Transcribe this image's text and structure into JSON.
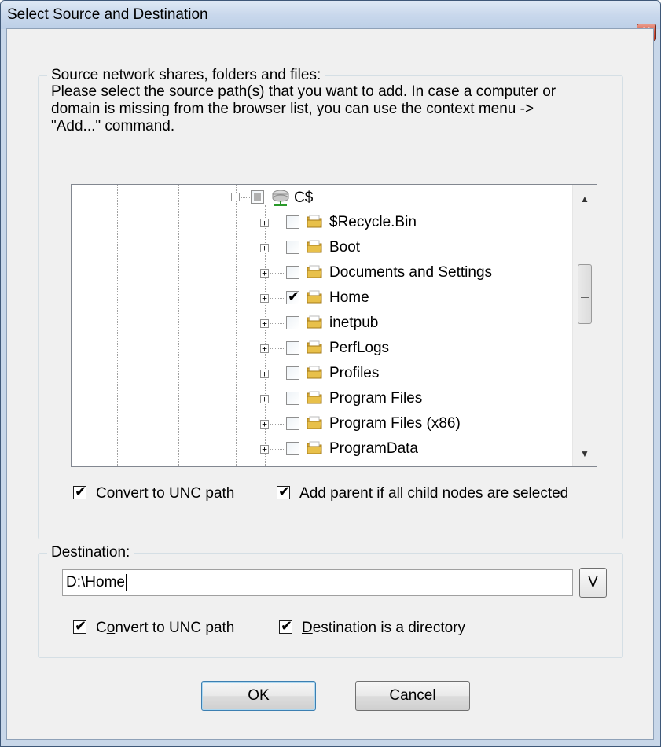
{
  "dialog": {
    "title": "Select Source and Destination",
    "close_label": "x"
  },
  "source_group": {
    "legend": "Source network shares, folders and files:",
    "description": "Please select the source path(s) that you want to add. In case a computer or domain is missing from the browser list, you can use the context menu -> \"Add...\" command."
  },
  "tree": {
    "root": {
      "label": "C$",
      "state": "partial",
      "expander": "−"
    },
    "items": [
      {
        "label": "$Recycle.Bin",
        "checked": false,
        "expander": "+"
      },
      {
        "label": "Boot",
        "checked": false,
        "expander": "+"
      },
      {
        "label": "Documents and Settings",
        "checked": false,
        "expander": "+"
      },
      {
        "label": "Home",
        "checked": true,
        "expander": "+"
      },
      {
        "label": "inetpub",
        "checked": false,
        "expander": "+"
      },
      {
        "label": "PerfLogs",
        "checked": false,
        "expander": "+"
      },
      {
        "label": "Profiles",
        "checked": false,
        "expander": "+"
      },
      {
        "label": "Program Files",
        "checked": false,
        "expander": "+"
      },
      {
        "label": "Program Files (x86)",
        "checked": false,
        "expander": "+"
      },
      {
        "label": "ProgramData",
        "checked": false,
        "expander": "+"
      }
    ],
    "scroll_up": "▲",
    "scroll_down": "▼"
  },
  "source_options": {
    "convert_unc": {
      "label_key": "C",
      "label_rest": "onvert to UNC path",
      "checked": true
    },
    "add_parent": {
      "label_key": "A",
      "label_rest": "dd parent if all child nodes are selected",
      "checked": true
    }
  },
  "destination_group": {
    "legend": "Destination:",
    "value": "D:\\Home",
    "browse_label": "V",
    "convert_unc": {
      "label_pre": "C",
      "label_key": "o",
      "label_rest": "nvert to UNC path",
      "checked": true
    },
    "is_directory": {
      "label_key": "D",
      "label_rest": "estination is a directory",
      "checked": true
    }
  },
  "buttons": {
    "ok": "OK",
    "cancel": "Cancel"
  },
  "colors": {
    "titlebar": "#c9d8ec",
    "close": "#d4553f",
    "folder": "#e8c04a"
  }
}
